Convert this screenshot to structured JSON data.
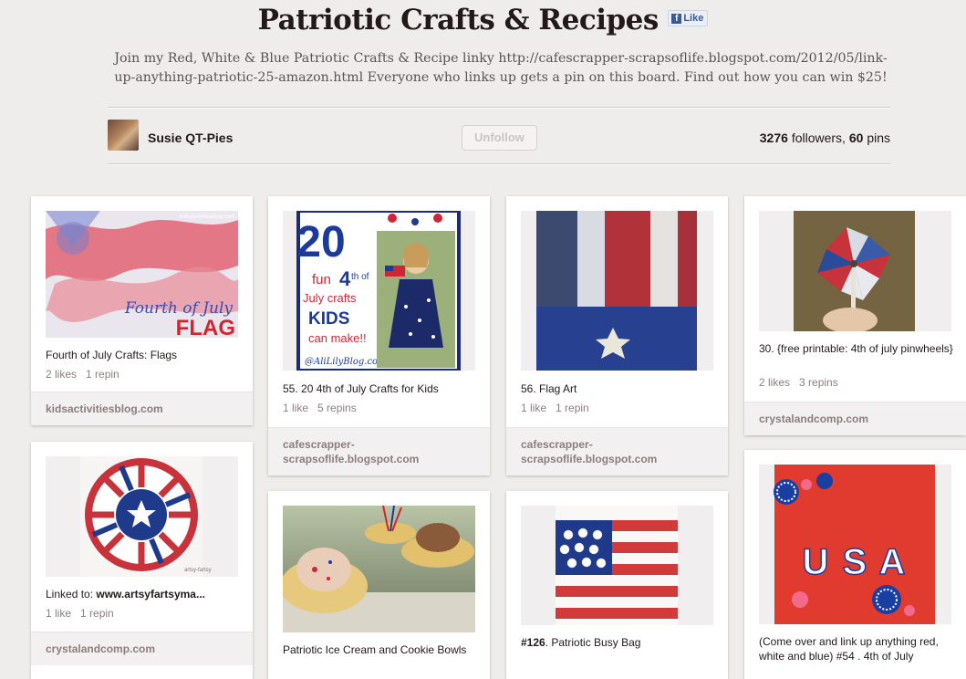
{
  "board": {
    "title": "Patriotic Crafts & Recipes",
    "like_label": "Like",
    "description": "Join my Red, White & Blue Patriotic Crafts & Recipe linky http://cafescrapper-scrapsoflife.blogspot.com/2012/05/link-up-anything-patriotic-25-amazon.html Everyone who links up gets a pin on this board. Find out how you can win $25!",
    "owner": "Susie QT-Pies",
    "unfollow_label": "Unfollow",
    "followers_count": "3276",
    "followers_word": "followers,",
    "pins_count": "60",
    "pins_word": "pins"
  },
  "pins": [
    {
      "desc": "Fourth of July Crafts: Flags",
      "likes": "2 likes",
      "repins": "1 repin",
      "source": "kidsactivitiesblog.com",
      "image_text": {
        "watermark": "KidsActivitiesBlog.com",
        "line1": "Fourth of July",
        "line2": "FLAG"
      }
    },
    {
      "desc": "Linked to: www.artsyfartsyma...",
      "desc_prefix": "Linked to: ",
      "desc_link": "www.artsyfartsyma...",
      "likes": "1 like",
      "repins": "1 repin",
      "source": "crystalandcomp.com",
      "image_text": {
        "watermark": "artsy-fartsy"
      }
    },
    {
      "desc": "55. 20 4th of July Crafts for Kids",
      "likes": "1 like",
      "repins": "5 repins",
      "source": "cafescrapper-scrapsoflife.blogspot.com",
      "image_text": {
        "big_num": "20",
        "fun": "fun",
        "num4": "4",
        "th_of": "th of",
        "july_crafts": "July crafts",
        "kids": "KIDS",
        "can_make": "can make!!",
        "blog": "@AliLilyBlog.com"
      }
    },
    {
      "desc": "Patriotic Ice Cream and Cookie Bowls"
    },
    {
      "desc": "56. Flag Art",
      "likes": "1 like",
      "repins": "1 repin",
      "source": "cafescrapper-scrapsoflife.blogspot.com"
    },
    {
      "desc_num": "#126",
      "desc": ". Patriotic Busy Bag"
    },
    {
      "desc": "30. {free printable: 4th of july pinwheels}",
      "likes": "2 likes",
      "repins": "3 repins",
      "source": "crystalandcomp.com"
    },
    {
      "desc": "(Come over and link up anything red, white and blue) #54 . 4th of July",
      "image_text": {
        "u": "U",
        "s": "S",
        "a": "A"
      }
    }
  ],
  "colors": {
    "flag_red": "#c8323a",
    "flag_blue": "#1f3a8a",
    "title_text": "#221919",
    "muted_text": "#8c7e7e",
    "facebook_blue": "#3b5998"
  }
}
